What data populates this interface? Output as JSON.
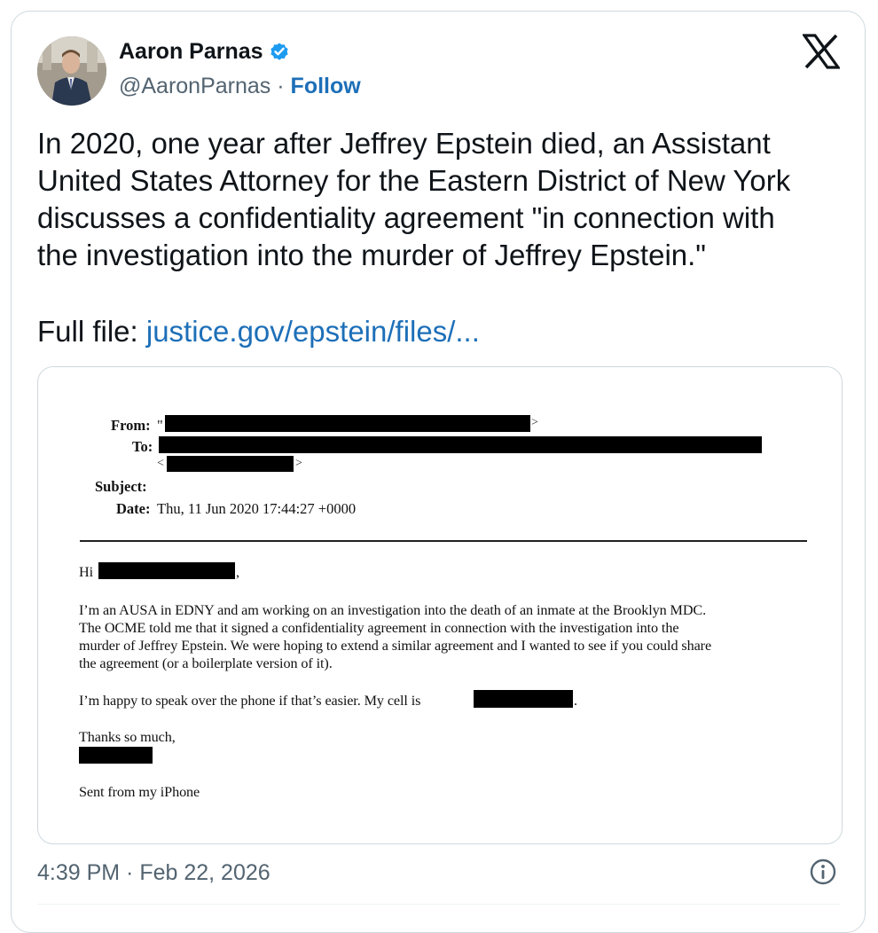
{
  "author": {
    "name": "Aaron Parnas",
    "handle": "@AaronParnas",
    "separator": "·",
    "follow_label": "Follow",
    "verified": true,
    "verified_color": "#1d9bf0",
    "avatar_icon": "profile-photo"
  },
  "platform_icon": "x-logo-icon",
  "tweet": {
    "lines": [
      "In 2020, one year after Jeffrey Epstein died, an Assistant",
      "United States Attorney for the Eastern District of New York",
      "discusses a confidentiality agreement \"in connection with",
      "the investigation into the murder of Jeffrey Epstein.\""
    ],
    "full_file_label": "Full file:",
    "link_text": "justice.gov/epstein/files/..."
  },
  "document": {
    "from_label": "From:",
    "from_prefix": "\"",
    "to_label": "To:",
    "subject_label": "Subject:",
    "date_label": "Date:",
    "date_value": "Thu, 11 Jun 2020 17:44:27 +0000",
    "greeting": "Hi",
    "greeting_comma": ",",
    "paragraph1": [
      "I’m an AUSA in EDNY and am working on an investigation into the death of an inmate at the Brooklyn MDC.",
      "The OCME told me that it signed a confidentiality agreement in connection with the investigation into the",
      "murder of Jeffrey Epstein. We were hoping to extend a similar agreement and I wanted to see if you could share",
      "the agreement (or a boilerplate version of it)."
    ],
    "paragraph2": "I’m happy to speak over the phone if that’s easier. My cell is",
    "paragraph2_end": ".",
    "signoff": "Thanks so much,",
    "sent_from": "Sent from my iPhone"
  },
  "footer": {
    "timestamp": "4:39 PM · Feb 22, 2026",
    "info_icon": "info-icon"
  },
  "colors": {
    "text": "#0f1419",
    "secondary": "#536471",
    "link": "#1d6fb8",
    "border": "#cfd9de",
    "redaction": "#000000"
  }
}
